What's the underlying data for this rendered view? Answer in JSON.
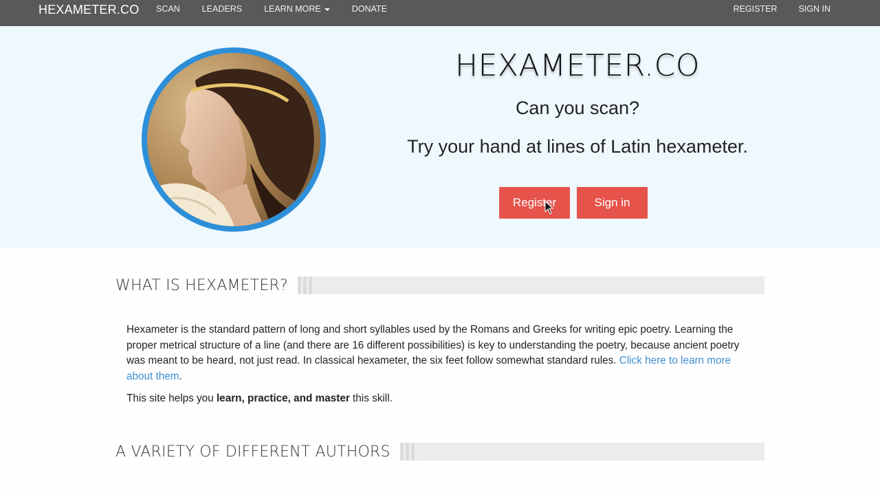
{
  "navbar": {
    "brand": "HEXAMETER.CO",
    "left_links": [
      "SCAN",
      "LEADERS",
      "LEARN MORE",
      "DONATE"
    ],
    "right_links": [
      "REGISTER",
      "SIGN IN"
    ]
  },
  "hero": {
    "title": "HEXAMETER.CO",
    "subtitle": "Can you scan?",
    "tagline": "Try your hand at lines of Latin hexameter.",
    "register_label": "Register",
    "signin_label": "Sign in"
  },
  "sections": {
    "what_title": "WHAT IS HEXAMETER?",
    "authors_title": "A VARIETY OF DIFFERENT AUTHORS"
  },
  "about": {
    "para1_text": "Hexameter is the standard pattern of long and short syllables used by the Romans and Greeks for writing epic poetry. Learning the proper metrical structure of a line (and there are 16 different possibilities) is key to understanding the poetry, because ancient poetry was meant to be heard, not just read. In classical hexameter, the six feet follow somewhat standard rules. ",
    "para1_link": "Click here to learn more about them",
    "para1_end": ".",
    "para2_start": "This site helps you ",
    "para2_bold": "learn, practice, and master",
    "para2_end": " this skill."
  },
  "colors": {
    "navbar_bg": "#595959",
    "hero_bg": "#eef8fd",
    "accent_button": "#e5534b",
    "portrait_border": "#2e8fd9",
    "link": "#3f8fd2"
  }
}
